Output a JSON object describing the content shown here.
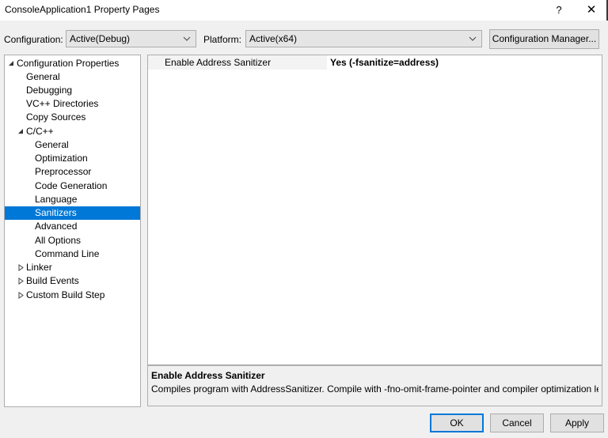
{
  "window": {
    "title": "ConsoleApplication1 Property Pages",
    "help_label": "?",
    "close_label": "✕"
  },
  "toolbar": {
    "configuration_label": "Configuration:",
    "configuration_value": "Active(Debug)",
    "platform_label": "Platform:",
    "platform_value": "Active(x64)",
    "config_manager_label": "Configuration Manager..."
  },
  "tree": {
    "items": [
      {
        "label": "Configuration Properties",
        "expanded": true
      },
      {
        "label": "General"
      },
      {
        "label": "Debugging"
      },
      {
        "label": "VC++ Directories"
      },
      {
        "label": "Copy Sources"
      },
      {
        "label": "C/C++",
        "expanded": true
      },
      {
        "label": "General"
      },
      {
        "label": "Optimization"
      },
      {
        "label": "Preprocessor"
      },
      {
        "label": "Code Generation"
      },
      {
        "label": "Language"
      },
      {
        "label": "Sanitizers",
        "selected": true
      },
      {
        "label": "Advanced"
      },
      {
        "label": "All Options"
      },
      {
        "label": "Command Line"
      },
      {
        "label": "Linker",
        "expanded": false
      },
      {
        "label": "Build Events",
        "expanded": false
      },
      {
        "label": "Custom Build Step",
        "expanded": false
      }
    ]
  },
  "grid": {
    "rows": [
      {
        "name": "Enable Address Sanitizer",
        "value": "Yes (-fsanitize=address)"
      }
    ]
  },
  "description": {
    "title": "Enable Address Sanitizer",
    "text": "Compiles program with AddressSanitizer. Compile with -fno-omit-frame-pointer and compiler optimization level ..."
  },
  "buttons": {
    "ok": "OK",
    "cancel": "Cancel",
    "apply": "Apply"
  },
  "colors": {
    "selection": "#0078d7",
    "background": "#f0f0f0"
  }
}
